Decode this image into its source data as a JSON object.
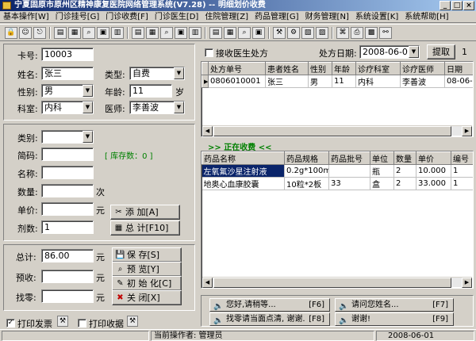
{
  "window": {
    "title": "宁夏固原市原州区精神康复医院网络管理系统(V7.28) -- 明细划价收费"
  },
  "menu": [
    "基本操作[W]",
    "门诊挂号[G]",
    "门诊收费[F]",
    "门诊医生[D]",
    "住院管理[Z]",
    "药品管理[G]",
    "财务管理[N]",
    "系统设置[K]",
    "系统帮助[H]"
  ],
  "patient": {
    "card_label": "卡号:",
    "card_value": "10003",
    "name_label": "姓名:",
    "name_value": "张三",
    "type_label": "类型:",
    "type_value": "自费",
    "sex_label": "性别:",
    "sex_value": "男",
    "age_label": "年龄:",
    "age_value": "11",
    "age_unit": "岁",
    "dept_label": "科室:",
    "dept_value": "内科",
    "doctor_label": "医师:",
    "doctor_value": "李善波"
  },
  "item": {
    "category_label": "类别:",
    "category_value": "",
    "code_label": "简码:",
    "code_value": "",
    "stock_text": "[ 库存数：0          ]",
    "name_label": "名称:",
    "name_value": "",
    "qty_label": "数量:",
    "qty_value": "",
    "qty_unit": "次",
    "price_label": "单价:",
    "price_value": "",
    "price_unit": "元",
    "doses_label": "剂数:",
    "doses_value": "1",
    "add_button": "添      加[A]",
    "total_button": "总      计[F10]"
  },
  "payment": {
    "total_label": "总计:",
    "total_value": "86.00",
    "total_unit": "元",
    "prepaid_label": "预收:",
    "prepaid_value": "",
    "prepaid_unit": "元",
    "change_label": "找零:",
    "change_value": "",
    "change_unit": "元",
    "save_button": "保      存[S]",
    "preview_button": "预      览[Y]",
    "init_button": "初  始  化[C]",
    "close_button": "关      闭[X]"
  },
  "print": {
    "invoice_label": "打印发票",
    "invoice_checked": true,
    "receipt_label": "打印收据",
    "receipt_checked": false
  },
  "prescription": {
    "receive_label": "接收医生处方",
    "date_label": "处方日期:",
    "date_value": "2008-06-01",
    "fetch_button": "提取",
    "fetch_count": "1",
    "columns": [
      "处方单号",
      "患者姓名",
      "性别",
      "年龄",
      "诊疗科室",
      "诊疗医师",
      "日期"
    ],
    "rows": [
      [
        "0806010001",
        "张三",
        "男",
        "11",
        "内科",
        "李善波",
        "08-06-0"
      ]
    ]
  },
  "charging": {
    "header": ">> 正在收费 <<",
    "columns": [
      "药品名称",
      "药品规格",
      "药品批号",
      "单位",
      "数量",
      "单价",
      "编号"
    ],
    "rows": [
      [
        "左氧氟沙星注射液",
        "0.2g*100ml",
        "",
        "瓶",
        "2",
        "10.000",
        "1"
      ],
      [
        "地奥心血康胶囊",
        "10粒*2板",
        "33",
        "盒",
        "2",
        "33.000",
        "1"
      ]
    ]
  },
  "voice": [
    {
      "text": "您好,请稍等...",
      "key": "[F6]"
    },
    {
      "text": "请问您姓名...",
      "key": "[F7]"
    },
    {
      "text": "找零请当面点清, 谢谢.",
      "key": "[F8]"
    },
    {
      "text": "谢谢!",
      "key": "[F9]"
    }
  ],
  "status": {
    "operator_text": "当前操作者: 管理员",
    "date_text": "2008-06-01"
  },
  "colors": {
    "title_bg": "#0a246a",
    "charging_header": "#008000",
    "selection": "#0a246a"
  }
}
